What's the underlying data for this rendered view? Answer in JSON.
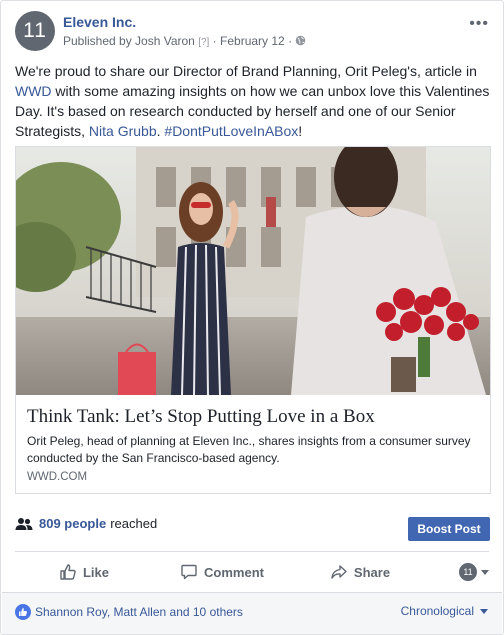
{
  "post": {
    "page_name": "Eleven Inc.",
    "avatar_text": "11",
    "published_by": "Published by Josh Varon",
    "help_marker": "[?]",
    "date": "February 12",
    "separator": "·",
    "privacy_icon": "globe-icon",
    "more_icon": "more-options-icon",
    "body": {
      "part1": "We're proud to share our Director of Brand Planning, Orit Peleg's, article in ",
      "link1": "WWD",
      "part2": " with some amazing insights on how we can unbox love this Valentines Day. It's based on research conducted by herself and one of our Senior Strategists, ",
      "link2": "Nita Grubb",
      "part3": ". ",
      "hashtag": "#DontPutLoveInABox",
      "part4": "!"
    }
  },
  "link_preview": {
    "title": "Think Tank: Let’s Stop Putting Love in a Box",
    "description": "Orit Peleg, head of planning at Eleven Inc., shares insights from a consumer survey conducted by the San Francisco-based agency.",
    "domain": "WWD.COM"
  },
  "reach": {
    "count": "809 people",
    "suffix": "reached",
    "icon": "people-icon"
  },
  "boost_label": "Boost Post",
  "actions": {
    "like": "Like",
    "comment": "Comment",
    "share": "Share",
    "actor_avatar": "11"
  },
  "footer": {
    "reactions": "Shannon Roy, Matt Allen and 10 others",
    "sort": "Chronological"
  },
  "colors": {
    "link": "#385898",
    "boost": "#4267b2",
    "avatar": "#606770"
  }
}
